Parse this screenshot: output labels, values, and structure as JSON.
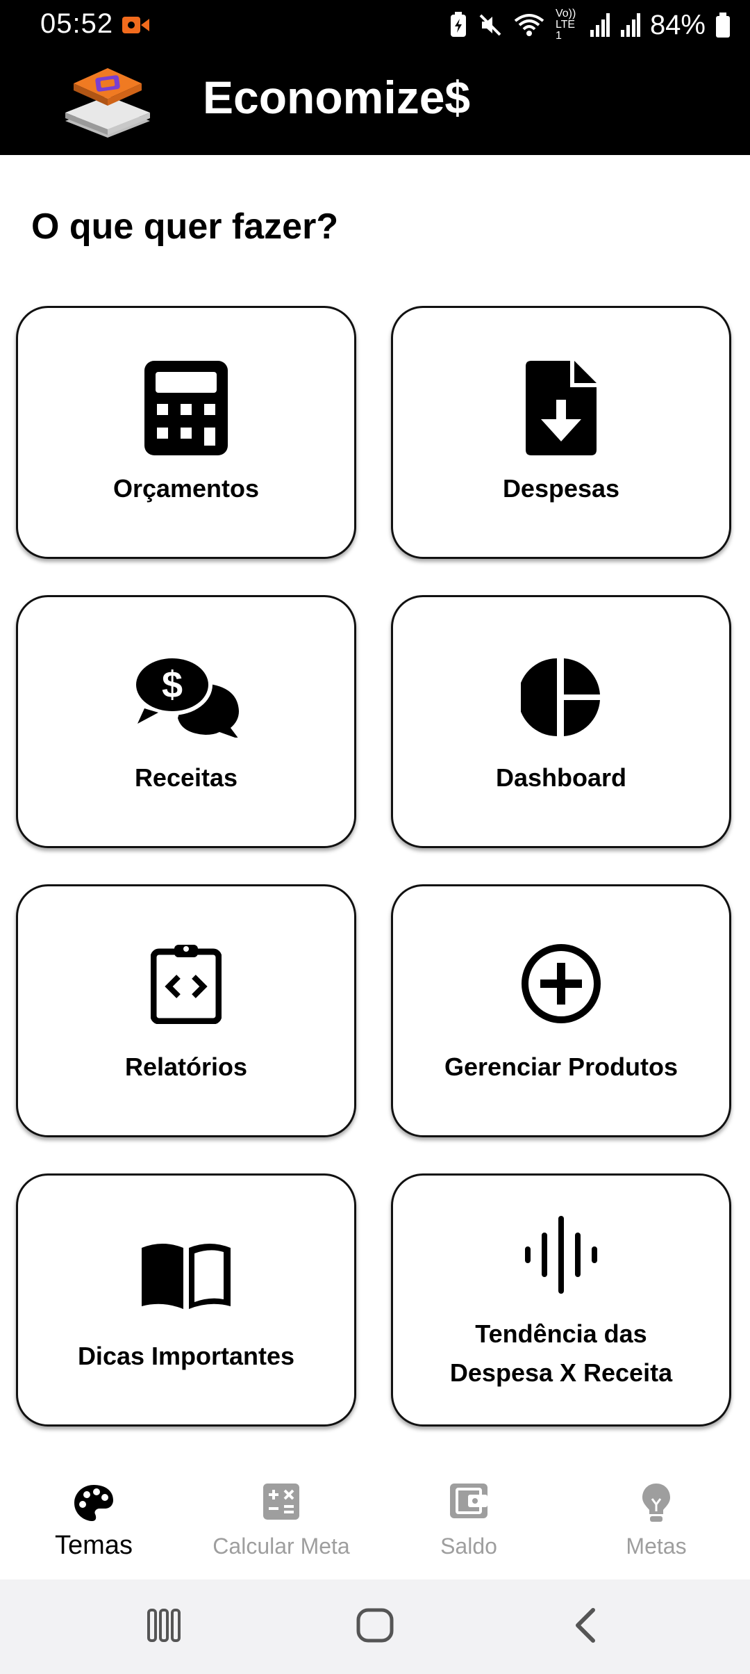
{
  "status_bar": {
    "time": "05:52",
    "battery": "84%",
    "network": "Vo)) LTE1"
  },
  "app": {
    "title": "Economize$",
    "logo_icon": "app-logo-icon"
  },
  "main": {
    "heading": "O que quer fazer?",
    "tiles": [
      {
        "label": "Orçamentos",
        "icon": "calculator-icon"
      },
      {
        "label": "Despesas",
        "icon": "file-download-icon"
      },
      {
        "label": "Receitas",
        "icon": "dollar-chat-icon"
      },
      {
        "label": "Dashboard",
        "icon": "pie-chart-icon"
      },
      {
        "label": "Relatórios",
        "icon": "clipboard-code-icon"
      },
      {
        "label": "Gerenciar Produtos",
        "icon": "plus-circle-icon"
      },
      {
        "label": "Dicas Importantes",
        "icon": "book-open-icon"
      },
      {
        "label_line1": "Tendência das",
        "label_line2": "Despesa X Receita",
        "icon": "waveform-icon"
      }
    ]
  },
  "bottom_nav": {
    "items": [
      {
        "label": "Temas",
        "icon": "palette-icon",
        "active": true
      },
      {
        "label": "Calcular Meta",
        "icon": "calculator-ops-icon",
        "active": false
      },
      {
        "label": "Saldo",
        "icon": "wallet-icon",
        "active": false
      },
      {
        "label": "Metas",
        "icon": "lightbulb-icon",
        "active": false
      }
    ]
  },
  "colors": {
    "bar_background": "#000000",
    "tile_border": "#111111",
    "nav_inactive": "#9e9e9e",
    "record_indicator": "#f26b1d",
    "logo_accent": "#f07a22"
  }
}
